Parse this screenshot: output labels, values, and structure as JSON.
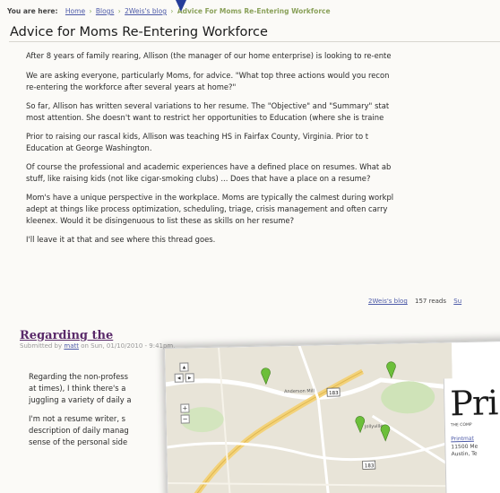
{
  "breadcrumb": {
    "prefix": "You are here:",
    "items": [
      "Home",
      "Blogs",
      "2Weis's blog"
    ],
    "separator": "›",
    "current": "Advice For Moms Re-Entering Workforce"
  },
  "page_title": "Advice for Moms Re-Entering Workforce",
  "post": {
    "paragraphs": [
      [
        "After 8 years of family rearing, Allison (the manager of our home enterprise) is looking to re-ente"
      ],
      [
        "We are asking everyone, particularly Moms, for advice. \"What top three actions would you recon",
        "re-entering the workforce after several years at home?\""
      ],
      [
        "So far, Allison has written several variations to her resume. The \"Objective\" and \"Summary\" stat",
        "most attention. She doesn't want to restrict her opportunities to Education (where she is traine"
      ],
      [
        "Prior to raising our rascal kids, Allison was teaching HS in Fairfax County, Virginia. Prior to t",
        "Education at George Washington."
      ],
      [
        "Of course the professional and academic experiences have a defined place on resumes. What ab",
        "stuff, like raising kids (not like cigar-smoking clubs) ... Does that have a place on a resume?"
      ],
      [
        "Mom's have a unique perspective in the workplace. Moms are typically the calmest during workpl",
        "adept at things like process optimization, scheduling, triage, crisis management and often carry",
        "kleenex. Would it be disingenuous to list these as skills on her resume?"
      ],
      [
        "I'll leave it at that and see where this thread goes."
      ]
    ],
    "links": {
      "blog": "2Weis's blog",
      "reads": "157 reads",
      "more": "Su"
    }
  },
  "comment": {
    "title": "Regarding the",
    "submitted": {
      "prefix": "Submitted by",
      "author": "matt",
      "suffix": "on Sun, 01/10/2010 - 9:41pm."
    },
    "paragraphs": [
      [
        "Regarding the non-profess",
        "at times), I think there's a",
        "juggling a variety of daily a"
      ],
      [
        "I'm not a resume writer, s",
        "description of daily manag",
        "sense of the personal side"
      ]
    ]
  },
  "map": {
    "place_labels": [
      "Anderson Mill",
      "Jollyville"
    ],
    "road_shields": [
      "183",
      "183"
    ],
    "zoom_buttons": [
      "+",
      "−"
    ],
    "pan_buttons": [
      "◂",
      "▴",
      "▸"
    ],
    "business": {
      "logo_text": "Pri",
      "tagline": "THE COMP",
      "link": "Printmat",
      "address_lines": [
        "11500 Me",
        "Austin, Te"
      ]
    }
  },
  "colors": {
    "link": "#4d5aa8",
    "breadcrumb_current": "#8aa15a",
    "comment_title": "#5a2a6a",
    "pointer": "#263d9a",
    "marker": "#6cbf3a"
  }
}
